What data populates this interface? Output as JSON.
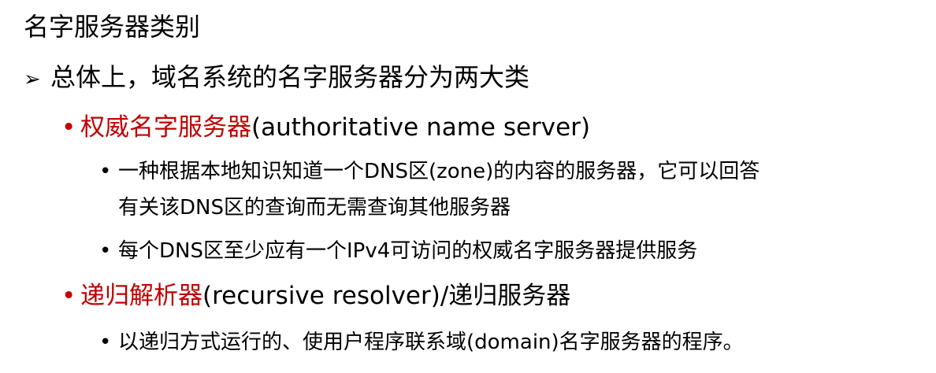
{
  "slide": {
    "title": "名字服务器类别",
    "point": {
      "marker": "➢",
      "text": "总体上，域名系统的名字服务器分为两大类"
    },
    "categories": [
      {
        "bullet": "•",
        "term": "权威名字服务器",
        "rest": "(authoritative name server)",
        "subs": [
          {
            "bullet": "•",
            "line1": "一种根据本地知识知道一个DNS区(zone)的内容的服务器，它可以回答",
            "line2": "有关该DNS区的查询而无需查询其他服务器"
          },
          {
            "bullet": "•",
            "line1": "每个DNS区至少应有一个IPv4可访问的权威名字服务器提供服务"
          }
        ]
      },
      {
        "bullet": "•",
        "term": "递归解析器",
        "rest": "(recursive resolver)/递归服务器",
        "subs": [
          {
            "bullet": "•",
            "line1": "以递归方式运行的、使用户程序联系域(domain)名字服务器的程序。"
          }
        ]
      }
    ]
  }
}
